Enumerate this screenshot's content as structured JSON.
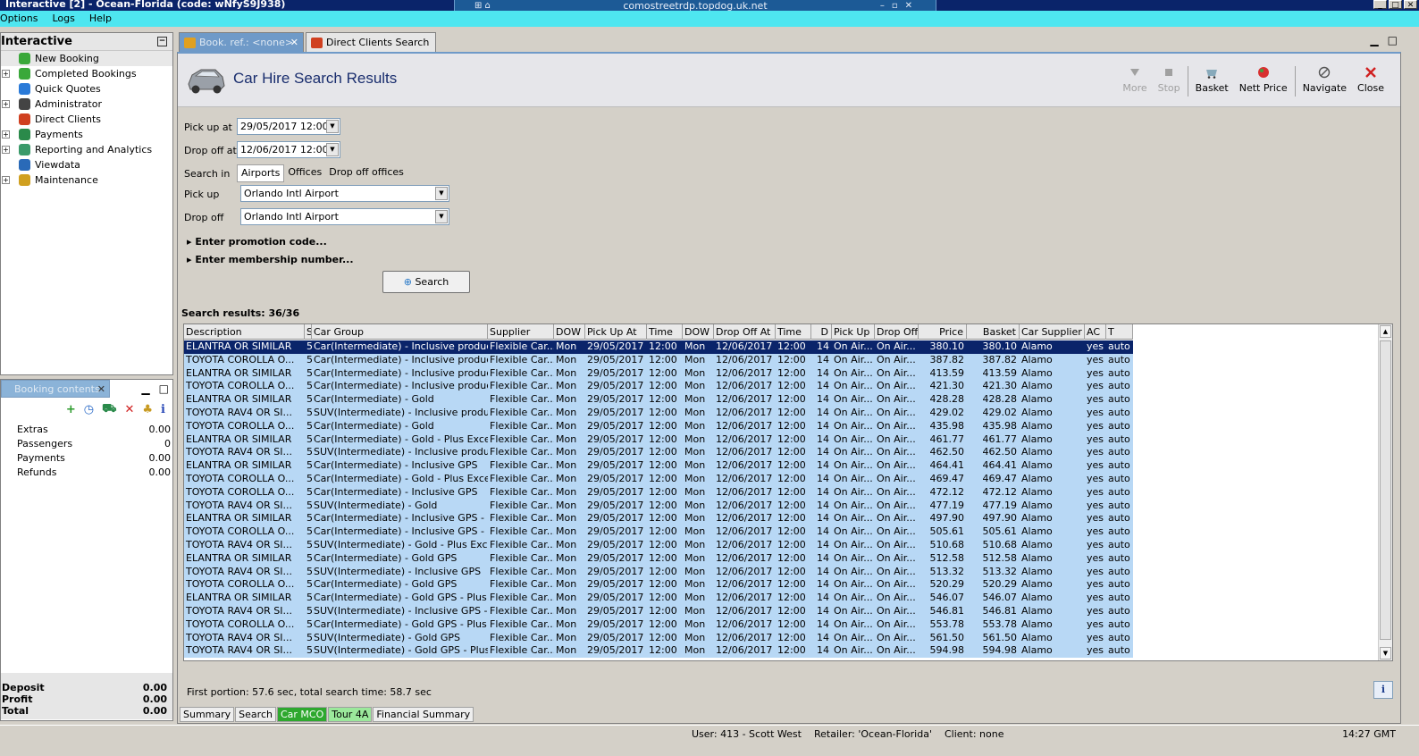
{
  "window": {
    "title": "Interactive [2] - Ocean-Florida (code: wNfyS9J938)",
    "rdp_host": "comostreetrdp.topdog.uk.net"
  },
  "menu": [
    "Options",
    "Logs",
    "Help"
  ],
  "nav": {
    "title": "Interactive",
    "items": [
      {
        "label": "New Booking",
        "expandable": false,
        "selected": true,
        "icon": "palm-tree-icon"
      },
      {
        "label": "Completed Bookings",
        "expandable": true,
        "icon": "palm-tree-icon"
      },
      {
        "label": "Quick Quotes",
        "expandable": false,
        "icon": "clock-icon"
      },
      {
        "label": "Administrator",
        "expandable": true,
        "icon": "person-icon"
      },
      {
        "label": "Direct Clients",
        "expandable": false,
        "icon": "star-icon"
      },
      {
        "label": "Payments",
        "expandable": true,
        "icon": "money-icon"
      },
      {
        "label": "Reporting and Analytics",
        "expandable": true,
        "icon": "report-icon"
      },
      {
        "label": "Viewdata",
        "expandable": false,
        "icon": "globe-icon"
      },
      {
        "label": "Maintenance",
        "expandable": true,
        "icon": "tools-icon"
      }
    ]
  },
  "booking": {
    "tab": "Booking contents",
    "rows": [
      {
        "label": "Extras",
        "value": "0.00"
      },
      {
        "label": "Passengers",
        "value": "0"
      },
      {
        "label": "Payments",
        "value": "0.00"
      },
      {
        "label": "Refunds",
        "value": "0.00"
      }
    ],
    "totals": [
      {
        "label": "Deposit",
        "value": "0.00"
      },
      {
        "label": "Profit",
        "value": "0.00"
      },
      {
        "label": "Total",
        "value": "0.00"
      }
    ]
  },
  "tabs": [
    {
      "label": "Book. ref.: <none>",
      "active": true
    },
    {
      "label": "Direct Clients Search",
      "active": false
    }
  ],
  "page": {
    "title": "Car Hire Search Results"
  },
  "toolbar": [
    {
      "label": "More",
      "disabled": true
    },
    {
      "label": "Stop",
      "disabled": true
    },
    {
      "label": "Basket"
    },
    {
      "label": "Nett Price"
    },
    {
      "label": "Navigate"
    },
    {
      "label": "Close"
    }
  ],
  "form": {
    "pickup_at_label": "Pick up at",
    "pickup_at": "29/05/2017 12:00",
    "dropoff_at_label": "Drop off at",
    "dropoff_at": "12/06/2017 12:00",
    "search_in_label": "Search in",
    "search_in_options": [
      "Airports",
      "Offices",
      "Drop off offices"
    ],
    "pickup_label": "Pick up",
    "pickup": "Orlando Intl Airport",
    "dropoff_label": "Drop off",
    "dropoff": "Orlando Intl Airport",
    "promo": "Enter promotion code...",
    "membership": "Enter membership number...",
    "search_button": "Search"
  },
  "results": {
    "label": "Search results: 36/36",
    "columns": [
      "Description",
      "S",
      "Car Group",
      "Supplier",
      "DOW",
      "Pick Up At",
      "Time",
      "DOW",
      "Drop Off At",
      "Time",
      "D",
      "Pick Up",
      "Drop Off",
      "Price",
      "Basket",
      "Car Supplier",
      "AC",
      "T"
    ],
    "rows": [
      [
        "ELANTRA OR SIMILAR",
        "5",
        "Car(Intermediate) - Inclusive product",
        "Flexible Car...",
        "Mon",
        "29/05/2017",
        "12:00",
        "Mon",
        "12/06/2017",
        "12:00",
        "14",
        "On Air...",
        "On Air...",
        "380.10",
        "380.10",
        "Alamo",
        "yes",
        "auto"
      ],
      [
        "TOYOTA COROLLA O...",
        "5",
        "Car(Intermediate) - Inclusive product",
        "Flexible Car...",
        "Mon",
        "29/05/2017",
        "12:00",
        "Mon",
        "12/06/2017",
        "12:00",
        "14",
        "On Air...",
        "On Air...",
        "387.82",
        "387.82",
        "Alamo",
        "yes",
        "auto"
      ],
      [
        "ELANTRA OR SIMILAR",
        "5",
        "Car(Intermediate) - Inclusive product ...",
        "Flexible Car...",
        "Mon",
        "29/05/2017",
        "12:00",
        "Mon",
        "12/06/2017",
        "12:00",
        "14",
        "On Air...",
        "On Air...",
        "413.59",
        "413.59",
        "Alamo",
        "yes",
        "auto"
      ],
      [
        "TOYOTA COROLLA O...",
        "5",
        "Car(Intermediate) - Inclusive product ...",
        "Flexible Car...",
        "Mon",
        "29/05/2017",
        "12:00",
        "Mon",
        "12/06/2017",
        "12:00",
        "14",
        "On Air...",
        "On Air...",
        "421.30",
        "421.30",
        "Alamo",
        "yes",
        "auto"
      ],
      [
        "ELANTRA OR SIMILAR",
        "5",
        "Car(Intermediate) - Gold",
        "Flexible Car...",
        "Mon",
        "29/05/2017",
        "12:00",
        "Mon",
        "12/06/2017",
        "12:00",
        "14",
        "On Air...",
        "On Air...",
        "428.28",
        "428.28",
        "Alamo",
        "yes",
        "auto"
      ],
      [
        "TOYOTA RAV4 OR SI...",
        "5",
        "SUV(Intermediate) - Inclusive product",
        "Flexible Car...",
        "Mon",
        "29/05/2017",
        "12:00",
        "Mon",
        "12/06/2017",
        "12:00",
        "14",
        "On Air...",
        "On Air...",
        "429.02",
        "429.02",
        "Alamo",
        "yes",
        "auto"
      ],
      [
        "TOYOTA COROLLA O...",
        "5",
        "Car(Intermediate) - Gold",
        "Flexible Car...",
        "Mon",
        "29/05/2017",
        "12:00",
        "Mon",
        "12/06/2017",
        "12:00",
        "14",
        "On Air...",
        "On Air...",
        "435.98",
        "435.98",
        "Alamo",
        "yes",
        "auto"
      ],
      [
        "ELANTRA OR SIMILAR",
        "5",
        "Car(Intermediate) - Gold - Plus Exces...",
        "Flexible Car...",
        "Mon",
        "29/05/2017",
        "12:00",
        "Mon",
        "12/06/2017",
        "12:00",
        "14",
        "On Air...",
        "On Air...",
        "461.77",
        "461.77",
        "Alamo",
        "yes",
        "auto"
      ],
      [
        "TOYOTA RAV4 OR SI...",
        "5",
        "SUV(Intermediate) - Inclusive product...",
        "Flexible Car...",
        "Mon",
        "29/05/2017",
        "12:00",
        "Mon",
        "12/06/2017",
        "12:00",
        "14",
        "On Air...",
        "On Air...",
        "462.50",
        "462.50",
        "Alamo",
        "yes",
        "auto"
      ],
      [
        "ELANTRA OR SIMILAR",
        "5",
        "Car(Intermediate) - Inclusive GPS",
        "Flexible Car...",
        "Mon",
        "29/05/2017",
        "12:00",
        "Mon",
        "12/06/2017",
        "12:00",
        "14",
        "On Air...",
        "On Air...",
        "464.41",
        "464.41",
        "Alamo",
        "yes",
        "auto"
      ],
      [
        "TOYOTA COROLLA O...",
        "5",
        "Car(Intermediate) - Gold - Plus Exces...",
        "Flexible Car...",
        "Mon",
        "29/05/2017",
        "12:00",
        "Mon",
        "12/06/2017",
        "12:00",
        "14",
        "On Air...",
        "On Air...",
        "469.47",
        "469.47",
        "Alamo",
        "yes",
        "auto"
      ],
      [
        "TOYOTA COROLLA O...",
        "5",
        "Car(Intermediate) - Inclusive GPS",
        "Flexible Car...",
        "Mon",
        "29/05/2017",
        "12:00",
        "Mon",
        "12/06/2017",
        "12:00",
        "14",
        "On Air...",
        "On Air...",
        "472.12",
        "472.12",
        "Alamo",
        "yes",
        "auto"
      ],
      [
        "TOYOTA RAV4 OR SI...",
        "5",
        "SUV(Intermediate) - Gold",
        "Flexible Car...",
        "Mon",
        "29/05/2017",
        "12:00",
        "Mon",
        "12/06/2017",
        "12:00",
        "14",
        "On Air...",
        "On Air...",
        "477.19",
        "477.19",
        "Alamo",
        "yes",
        "auto"
      ],
      [
        "ELANTRA OR SIMILAR",
        "5",
        "Car(Intermediate) - Inclusive GPS - Pl...",
        "Flexible Car...",
        "Mon",
        "29/05/2017",
        "12:00",
        "Mon",
        "12/06/2017",
        "12:00",
        "14",
        "On Air...",
        "On Air...",
        "497.90",
        "497.90",
        "Alamo",
        "yes",
        "auto"
      ],
      [
        "TOYOTA COROLLA O...",
        "5",
        "Car(Intermediate) - Inclusive GPS - Pl...",
        "Flexible Car...",
        "Mon",
        "29/05/2017",
        "12:00",
        "Mon",
        "12/06/2017",
        "12:00",
        "14",
        "On Air...",
        "On Air...",
        "505.61",
        "505.61",
        "Alamo",
        "yes",
        "auto"
      ],
      [
        "TOYOTA RAV4 OR SI...",
        "5",
        "SUV(Intermediate) - Gold - Plus Exces...",
        "Flexible Car...",
        "Mon",
        "29/05/2017",
        "12:00",
        "Mon",
        "12/06/2017",
        "12:00",
        "14",
        "On Air...",
        "On Air...",
        "510.68",
        "510.68",
        "Alamo",
        "yes",
        "auto"
      ],
      [
        "ELANTRA OR SIMILAR",
        "5",
        "Car(Intermediate) - Gold GPS",
        "Flexible Car...",
        "Mon",
        "29/05/2017",
        "12:00",
        "Mon",
        "12/06/2017",
        "12:00",
        "14",
        "On Air...",
        "On Air...",
        "512.58",
        "512.58",
        "Alamo",
        "yes",
        "auto"
      ],
      [
        "TOYOTA RAV4 OR SI...",
        "5",
        "SUV(Intermediate) - Inclusive GPS",
        "Flexible Car...",
        "Mon",
        "29/05/2017",
        "12:00",
        "Mon",
        "12/06/2017",
        "12:00",
        "14",
        "On Air...",
        "On Air...",
        "513.32",
        "513.32",
        "Alamo",
        "yes",
        "auto"
      ],
      [
        "TOYOTA COROLLA O...",
        "5",
        "Car(Intermediate) - Gold GPS",
        "Flexible Car...",
        "Mon",
        "29/05/2017",
        "12:00",
        "Mon",
        "12/06/2017",
        "12:00",
        "14",
        "On Air...",
        "On Air...",
        "520.29",
        "520.29",
        "Alamo",
        "yes",
        "auto"
      ],
      [
        "ELANTRA OR SIMILAR",
        "5",
        "Car(Intermediate) - Gold GPS - Plus E...",
        "Flexible Car...",
        "Mon",
        "29/05/2017",
        "12:00",
        "Mon",
        "12/06/2017",
        "12:00",
        "14",
        "On Air...",
        "On Air...",
        "546.07",
        "546.07",
        "Alamo",
        "yes",
        "auto"
      ],
      [
        "TOYOTA RAV4 OR SI...",
        "5",
        "SUV(Intermediate) - Inclusive GPS - Pl...",
        "Flexible Car...",
        "Mon",
        "29/05/2017",
        "12:00",
        "Mon",
        "12/06/2017",
        "12:00",
        "14",
        "On Air...",
        "On Air...",
        "546.81",
        "546.81",
        "Alamo",
        "yes",
        "auto"
      ],
      [
        "TOYOTA COROLLA O...",
        "5",
        "Car(Intermediate) - Gold GPS - Plus E...",
        "Flexible Car...",
        "Mon",
        "29/05/2017",
        "12:00",
        "Mon",
        "12/06/2017",
        "12:00",
        "14",
        "On Air...",
        "On Air...",
        "553.78",
        "553.78",
        "Alamo",
        "yes",
        "auto"
      ],
      [
        "TOYOTA RAV4 OR SI...",
        "5",
        "SUV(Intermediate) - Gold GPS",
        "Flexible Car...",
        "Mon",
        "29/05/2017",
        "12:00",
        "Mon",
        "12/06/2017",
        "12:00",
        "14",
        "On Air...",
        "On Air...",
        "561.50",
        "561.50",
        "Alamo",
        "yes",
        "auto"
      ],
      [
        "TOYOTA RAV4 OR SI...",
        "5",
        "SUV(Intermediate) - Gold GPS - Plus E...",
        "Flexible Car...",
        "Mon",
        "29/05/2017",
        "12:00",
        "Mon",
        "12/06/2017",
        "12:00",
        "14",
        "On Air...",
        "On Air...",
        "594.98",
        "594.98",
        "Alamo",
        "yes",
        "auto"
      ]
    ]
  },
  "footer": {
    "timing": "First portion: 57.6 sec, total search time: 58.7 sec",
    "info": "i"
  },
  "bottom_tabs": [
    "Summary",
    "Search",
    "Car MCO",
    "Tour 4A",
    "Financial Summary"
  ],
  "status": {
    "user": "User: 413 - Scott West",
    "retailer": "Retailer: 'Ocean-Florida'",
    "client": "Client: none",
    "time": "14:27 GMT"
  },
  "colors": {
    "title_bar": "#0a246a",
    "menu_bar": "#4ee6f0",
    "row_bg": "#b8d8f5",
    "row_selected": "#0a246a",
    "tab_active": "#6f9ac8",
    "tab_green": "#2ea82e"
  }
}
